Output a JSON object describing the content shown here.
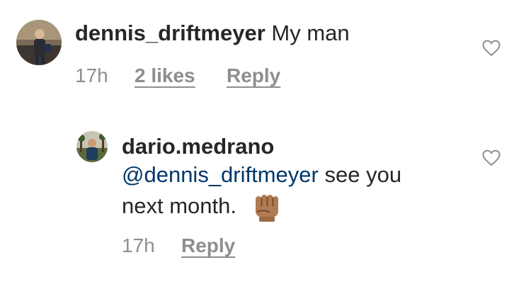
{
  "comments": [
    {
      "username": "dennis_driftmeyer",
      "text": "My man",
      "time": "17h",
      "likes": "2 likes",
      "reply": "Reply",
      "avatar_icon": "avatar-photo-icon",
      "like_icon": "heart-outline-icon"
    },
    {
      "username": "dario.medrano",
      "mention": "@dennis_driftmeyer",
      "text_line1": "see you",
      "text_line2": "next month.",
      "emoji": "✊🏽",
      "time": "17h",
      "reply": "Reply",
      "avatar_icon": "avatar-photo-icon",
      "like_icon": "heart-outline-icon"
    }
  ],
  "colors": {
    "text": "#262626",
    "meta": "#8e8e8e",
    "mention": "#00376b"
  }
}
